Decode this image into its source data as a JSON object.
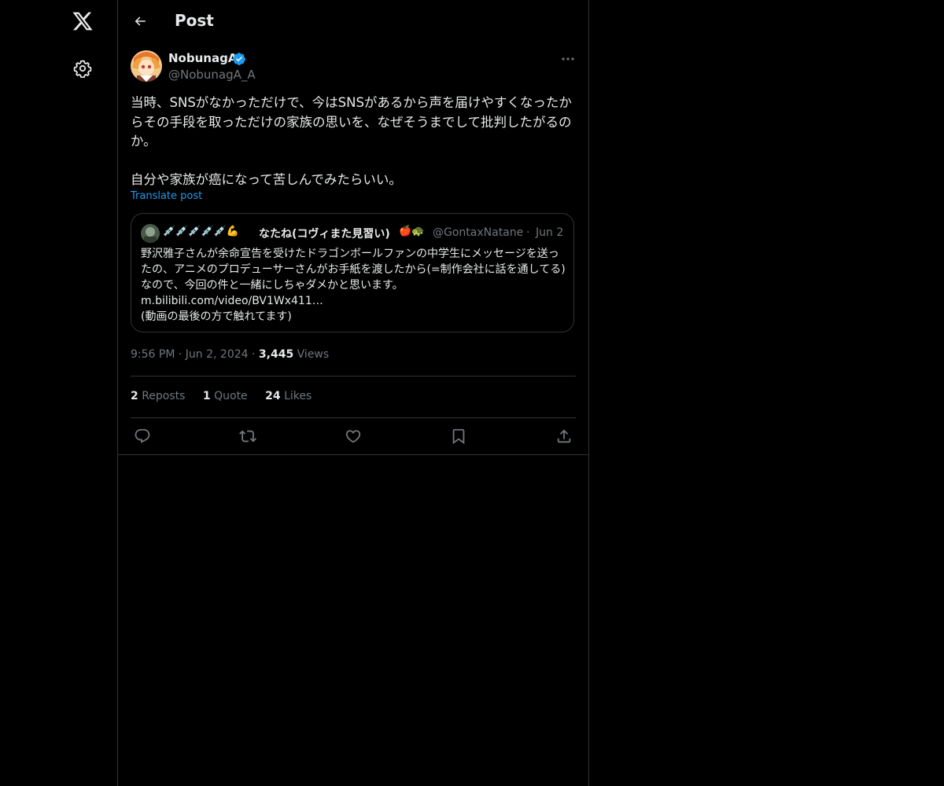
{
  "header": {
    "title": "Post"
  },
  "post": {
    "display_name": "NobunagA",
    "handle": "@NobunagA_A",
    "text": "当時、SNSがなかっただけで、今はSNSがあるから声を届けやすくなったからその手段を取っただけの家族の思いを、なぜそうまでして批判したがるのか。\n\n自分や家族が癌になって苦しんでみたらいい。",
    "translate_label": "Translate post",
    "time": "9:56 PM",
    "date": "Jun 2, 2024",
    "views_count": "3,445",
    "views_label": "Views",
    "reposts_count": "2",
    "reposts_label": "Reposts",
    "quotes_count": "1",
    "quotes_label": "Quote",
    "likes_count": "24",
    "likes_label": "Likes"
  },
  "quote": {
    "emoji_prefix": "💉💉💉💉💉💪",
    "display_name": "なたね(コヴィまた見習い)",
    "emoji_suffix": "🍎🐢",
    "handle": "@GontaxNatane",
    "date": "Jun 2",
    "text": "野沢雅子さんが余命宣告を受けたドラゴンボールファンの中学生にメッセージを送ったの、アニメのプロデューサーさんがお手紙を渡したから(=制作会社に話を通してる)なので、今回の件と一緒にしちゃダメかと思います。\nm.bilibili.com/video/BV1Wx411…\n(動画の最後の方で触れてます)"
  },
  "icons": {
    "logo": "x-logo-icon",
    "settings": "gear-icon",
    "back": "back-arrow-icon",
    "verified": "verified-badge-icon",
    "more": "more-dots-icon",
    "reply": "reply-icon",
    "repost": "repost-icon",
    "like": "heart-icon",
    "bookmark": "bookmark-icon",
    "share": "share-icon"
  },
  "colors": {
    "accent": "#1d9bf0",
    "background": "#000000",
    "text": "#e7e9ea",
    "secondary_text": "#71767b",
    "border": "#2f3336"
  }
}
